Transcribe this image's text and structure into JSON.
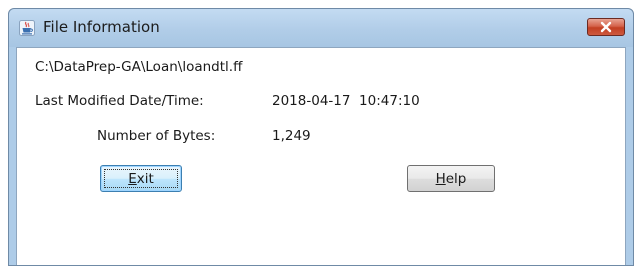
{
  "window": {
    "title": "File Information",
    "app_icon": "java-cup-icon",
    "close_icon": "close-icon"
  },
  "file": {
    "path": "C:\\DataPrep-GA\\Loan\\loandtl.ff",
    "modified_label": "Last Modified Date/Time:",
    "modified_value": "2018-04-17  10:47:10",
    "bytes_label": "Number of Bytes:",
    "bytes_value": "1,249"
  },
  "buttons": {
    "exit": {
      "mnemonic": "E",
      "rest": "xit"
    },
    "help": {
      "mnemonic": "H",
      "rest": "elp"
    }
  },
  "colors": {
    "titlebar": "#aecce8",
    "close_button": "#c84a2e",
    "default_button_border": "#3c7fb1"
  }
}
